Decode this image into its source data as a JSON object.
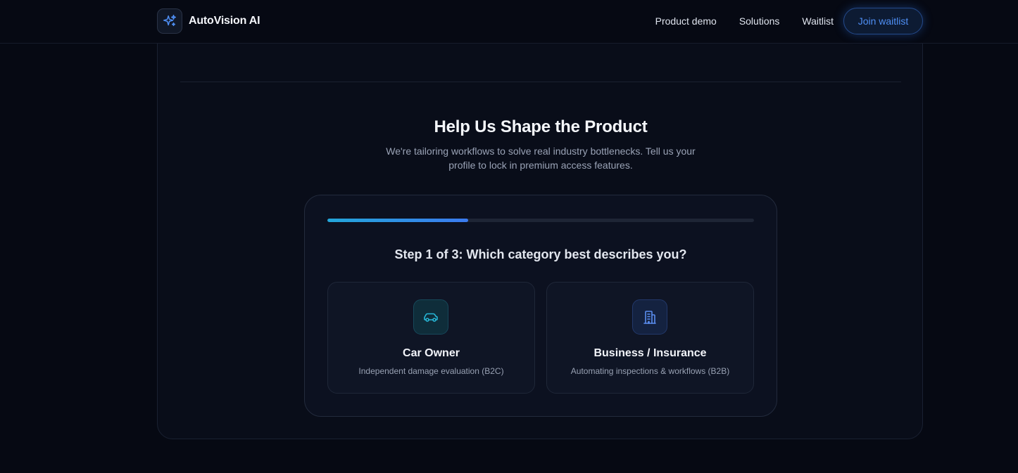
{
  "header": {
    "brand_name": "AutoVision AI",
    "nav": [
      "Product demo",
      "Solutions",
      "Waitlist"
    ],
    "cta_label": "Join waitlist"
  },
  "main": {
    "title": "Help Us Shape the Product",
    "subtitle": "We're tailoring workflows to solve real industry bottlenecks. Tell us your profile to lock in premium access features."
  },
  "survey": {
    "progress": 0.33,
    "question": "Step 1 of 3: Which category best describes you?",
    "options": [
      {
        "title": "Car Owner",
        "description": "Independent damage evaluation (B2C)",
        "icon": "car-icon"
      },
      {
        "title": "Business / Insurance",
        "description": "Automating inspections & workflows (B2B)",
        "icon": "building-icon"
      }
    ]
  },
  "colors": {
    "background": "#060913",
    "accent_blue": "#3b7bf0",
    "accent_teal": "#23a6d9"
  }
}
